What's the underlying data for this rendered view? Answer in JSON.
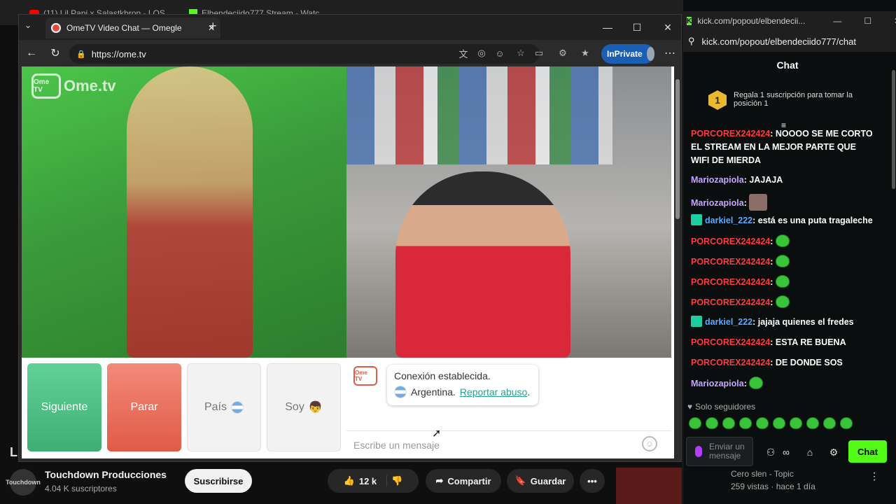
{
  "youtube": {
    "tabs": [
      "(11) Lil Papi x Salastkbron - LOS",
      "Elbendeciido777 Stream - Watc"
    ],
    "side_letter": "L",
    "channel_name": "Touchdown Producciones",
    "channel_avatar_text": "Touchdown",
    "subscribers": "4.04 K suscriptores",
    "subscribe_label": "Suscribirse",
    "like_count": "12 k",
    "share_label": "Compartir",
    "save_label": "Guardar",
    "more_label": "•••",
    "rec_title": "Cero slen - Topic",
    "rec_meta": "259 vistas · hace 1 día"
  },
  "browser": {
    "tab_title": "OmeTV Video Chat — Omegle",
    "url": "https://ome.tv",
    "inprivate_label": "InPrivate",
    "minimize": "—",
    "maximize": "☐",
    "close": "✕",
    "menu": "⋯"
  },
  "ometv": {
    "logo_tv": "Ome TV",
    "logo_text": "Ome.tv",
    "next_label": "Siguiente",
    "stop_label": "Parar",
    "country_label": "País",
    "gender_label": "Soy",
    "message_logo": "Ome TV",
    "message_title": "Conexión establecida.",
    "message_country": "Argentina.",
    "report_link": "Reportar abuso",
    "report_suffix": ".",
    "input_placeholder": "Escribe un mensaje"
  },
  "kick": {
    "window_title": "kick.com/popout/elbendecii...",
    "url": "kick.com/popout/elbendeciido777/chat",
    "header": "Chat",
    "promo_rank": "1",
    "promo_text": "Regala 1 suscripción para tomar la posición 1",
    "messages": [
      {
        "user": "PORCOREX242424",
        "text": ": NOOOO SE ME CORTO EL STREAM EN LA MEJOR PARTE QUE WIFI DE MIERDA"
      },
      {
        "user": "Mariozapiola",
        "text": ": JAJAJA"
      },
      {
        "user": "Mariozapiola",
        "text": ":"
      },
      {
        "user": "darkiel_222",
        "text": ": está es una puta tragaleche"
      },
      {
        "user": "PORCOREX242424",
        "text": ":"
      },
      {
        "user": "PORCOREX242424",
        "text": ":"
      },
      {
        "user": "PORCOREX242424",
        "text": ":"
      },
      {
        "user": "PORCOREX242424",
        "text": ":"
      },
      {
        "user": "darkiel_222",
        "text": ": jajaja quienes el fredes"
      },
      {
        "user": "PORCOREX242424",
        "text": ": ESTA RE BUENA"
      },
      {
        "user": "PORCOREX242424",
        "text": ": DE DONDE SOS"
      },
      {
        "user": "Mariozapiola",
        "text": ":"
      }
    ],
    "only_followers": "Solo seguidores",
    "input_placeholder": "Enviar un mensaje",
    "chat_button": "Chat"
  }
}
